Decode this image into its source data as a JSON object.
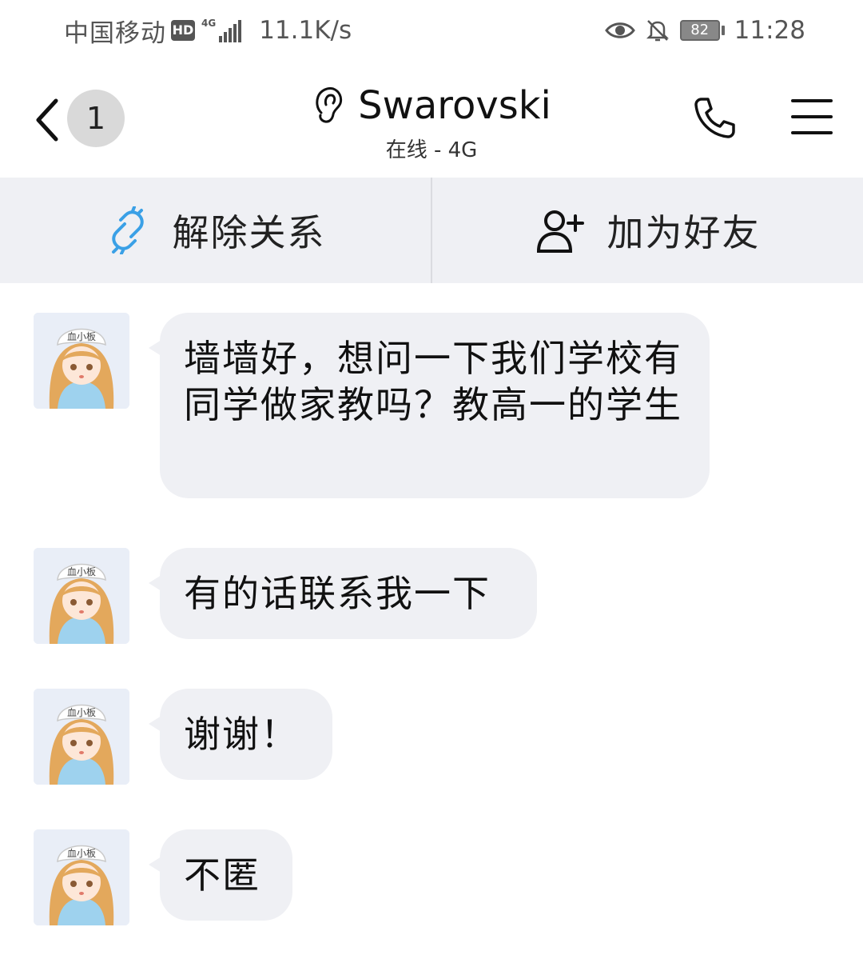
{
  "status_bar": {
    "carrier": "中国移动",
    "hd": "HD",
    "network_tag": "4G",
    "speed": "11.1K/s",
    "battery": "82",
    "time": "11:28",
    "icons": [
      "eye-icon",
      "mute-bell-icon",
      "battery-icon"
    ]
  },
  "header": {
    "unread_count": "1",
    "title": "Swarovski",
    "subtitle": "在线 - 4G"
  },
  "actions": {
    "unlink_label": "解除关系",
    "add_friend_label": "加为好友",
    "unlink_color": "#3aa0e6"
  },
  "messages": [
    {
      "text": "墙墙好，想问一下我们学校有同学做家教吗？教高一的学生"
    },
    {
      "text": "有的话联系我一下"
    },
    {
      "text": "谢谢！"
    },
    {
      "text": "不匿"
    }
  ],
  "colors": {
    "bubble": "#eff0f4",
    "action_bar": "#eff0f4"
  }
}
